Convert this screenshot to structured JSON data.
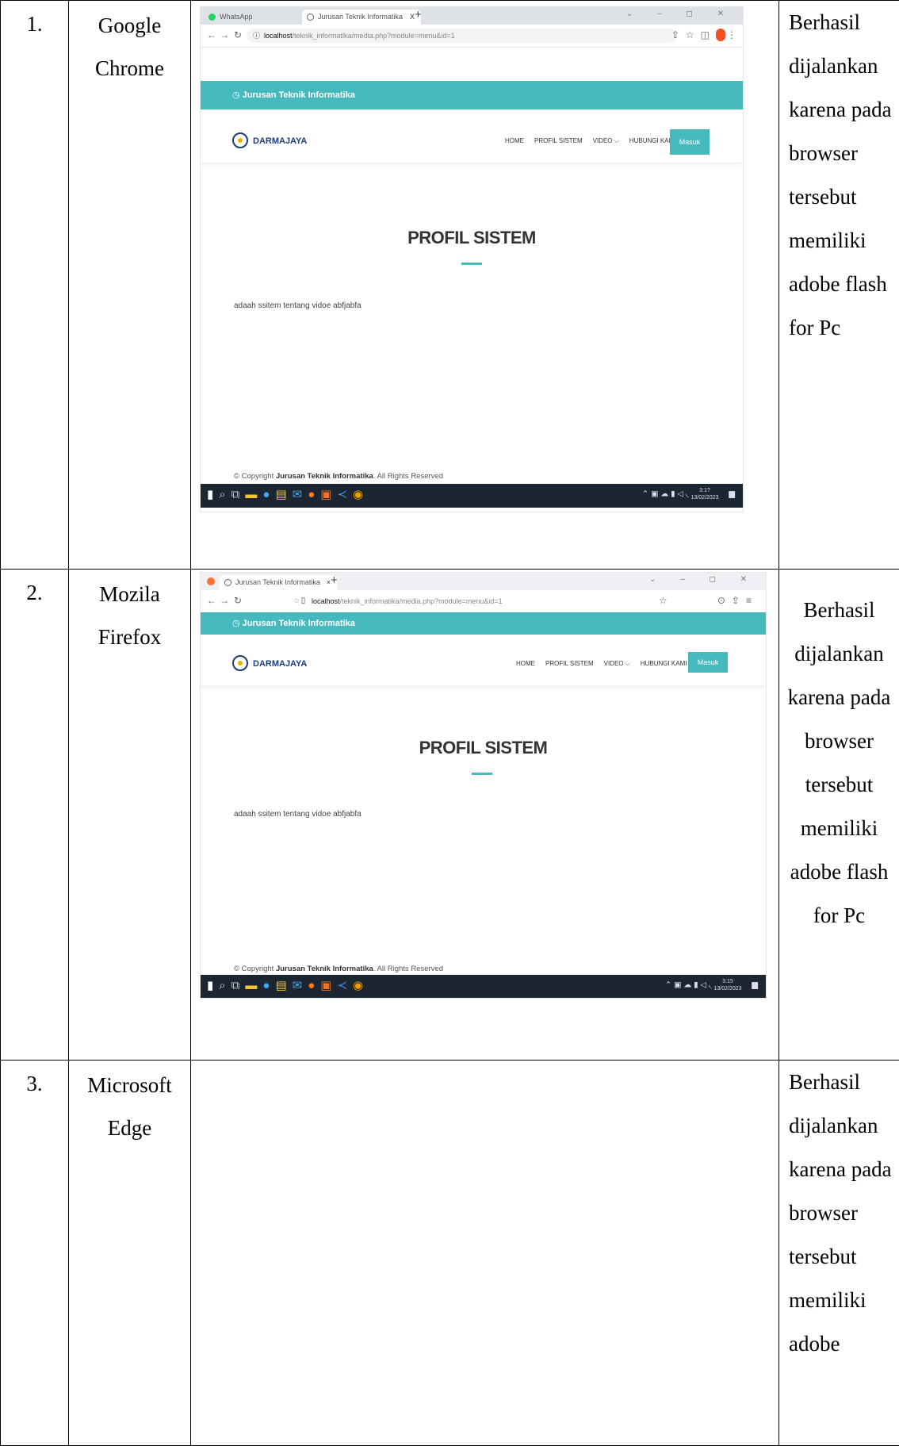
{
  "rows": [
    {
      "no": "1.",
      "browser": "Google Chrome",
      "result": "Berhasil dijalankan karena pada browser tersebut memiliki adobe flash for Pc"
    },
    {
      "no": "2.",
      "browser": "Mozila Firefox",
      "result": "Berhasil dijalankan karena pada browser tersebut memiliki adobe flash for Pc"
    },
    {
      "no": "3.",
      "browser": "Microsoft Edge",
      "result": "Berhasil dijalankan karena pada browser tersebut memiliki adobe"
    }
  ],
  "chrome_shot": {
    "tab1": "WhatsApp",
    "tab2": "Jurusan Teknik Informatika",
    "tab_close": "X",
    "new_tab": "+",
    "url_host": "localhost",
    "url_path": "/teknik_informatika/media.php?module=menu&id=1",
    "clock_time": "3:1?",
    "clock_date": "13/02/2023"
  },
  "firefox_shot": {
    "tab1": "Jurusan Teknik Informatika",
    "tab_close": "×",
    "new_tab": "+",
    "url_host": "localhost",
    "url_path": "/teknik_informatika/media.php?module=menu&id=1",
    "clock_time": "3:15",
    "clock_date": "13/02/2023"
  },
  "site": {
    "topbar": "Jurusan Teknik Informatika",
    "logo": "DARMAJAYA",
    "menu": [
      "HOME",
      "PROFIL SISTEM",
      "VIDEO ⌵",
      "HUBUNGI KAMI"
    ],
    "login_button": "Masuk",
    "page_title": "PROFIL SISTEM",
    "content": "adaah ssitem tentang vidoe abfjabfa",
    "copyright_pre": "© Copyright",
    "copyright_org": "Jurusan Teknik Informatika",
    "copyright_post": ". All Rights Reserved"
  },
  "colors": {
    "accent": "#45b9be",
    "taskbar": "#1c2633",
    "logo": "#1d3c7a"
  },
  "icons": [
    "back-icon",
    "forward-icon",
    "reload-icon",
    "info-icon",
    "share-icon",
    "star-icon",
    "sidebar-icon",
    "profile-icon",
    "menu-dots-icon",
    "clock-icon",
    "windows-start-icon",
    "search-icon",
    "taskview-icon",
    "shield-icon",
    "hamburger-icon"
  ]
}
